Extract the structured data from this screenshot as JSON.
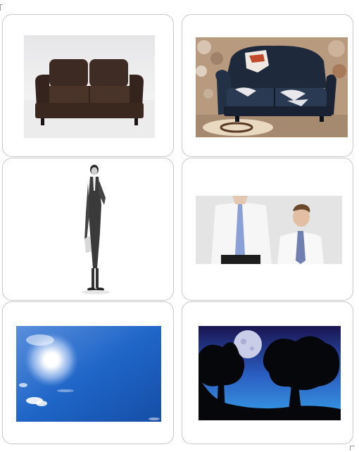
{
  "grid": {
    "cards": [
      {
        "picture": "brown-sofa-image"
      },
      {
        "picture": "damaged-leather-sofa-image"
      },
      {
        "picture": "tall-man-illustration-image"
      },
      {
        "picture": "tall-and-short-men-image"
      },
      {
        "picture": "bright-sun-sky-image"
      },
      {
        "picture": "moon-night-trees-image"
      }
    ]
  },
  "colors": {
    "card_border": "#c9c9c9",
    "sky_blue": "#1f66c8",
    "night_sky": "#1a1450"
  }
}
